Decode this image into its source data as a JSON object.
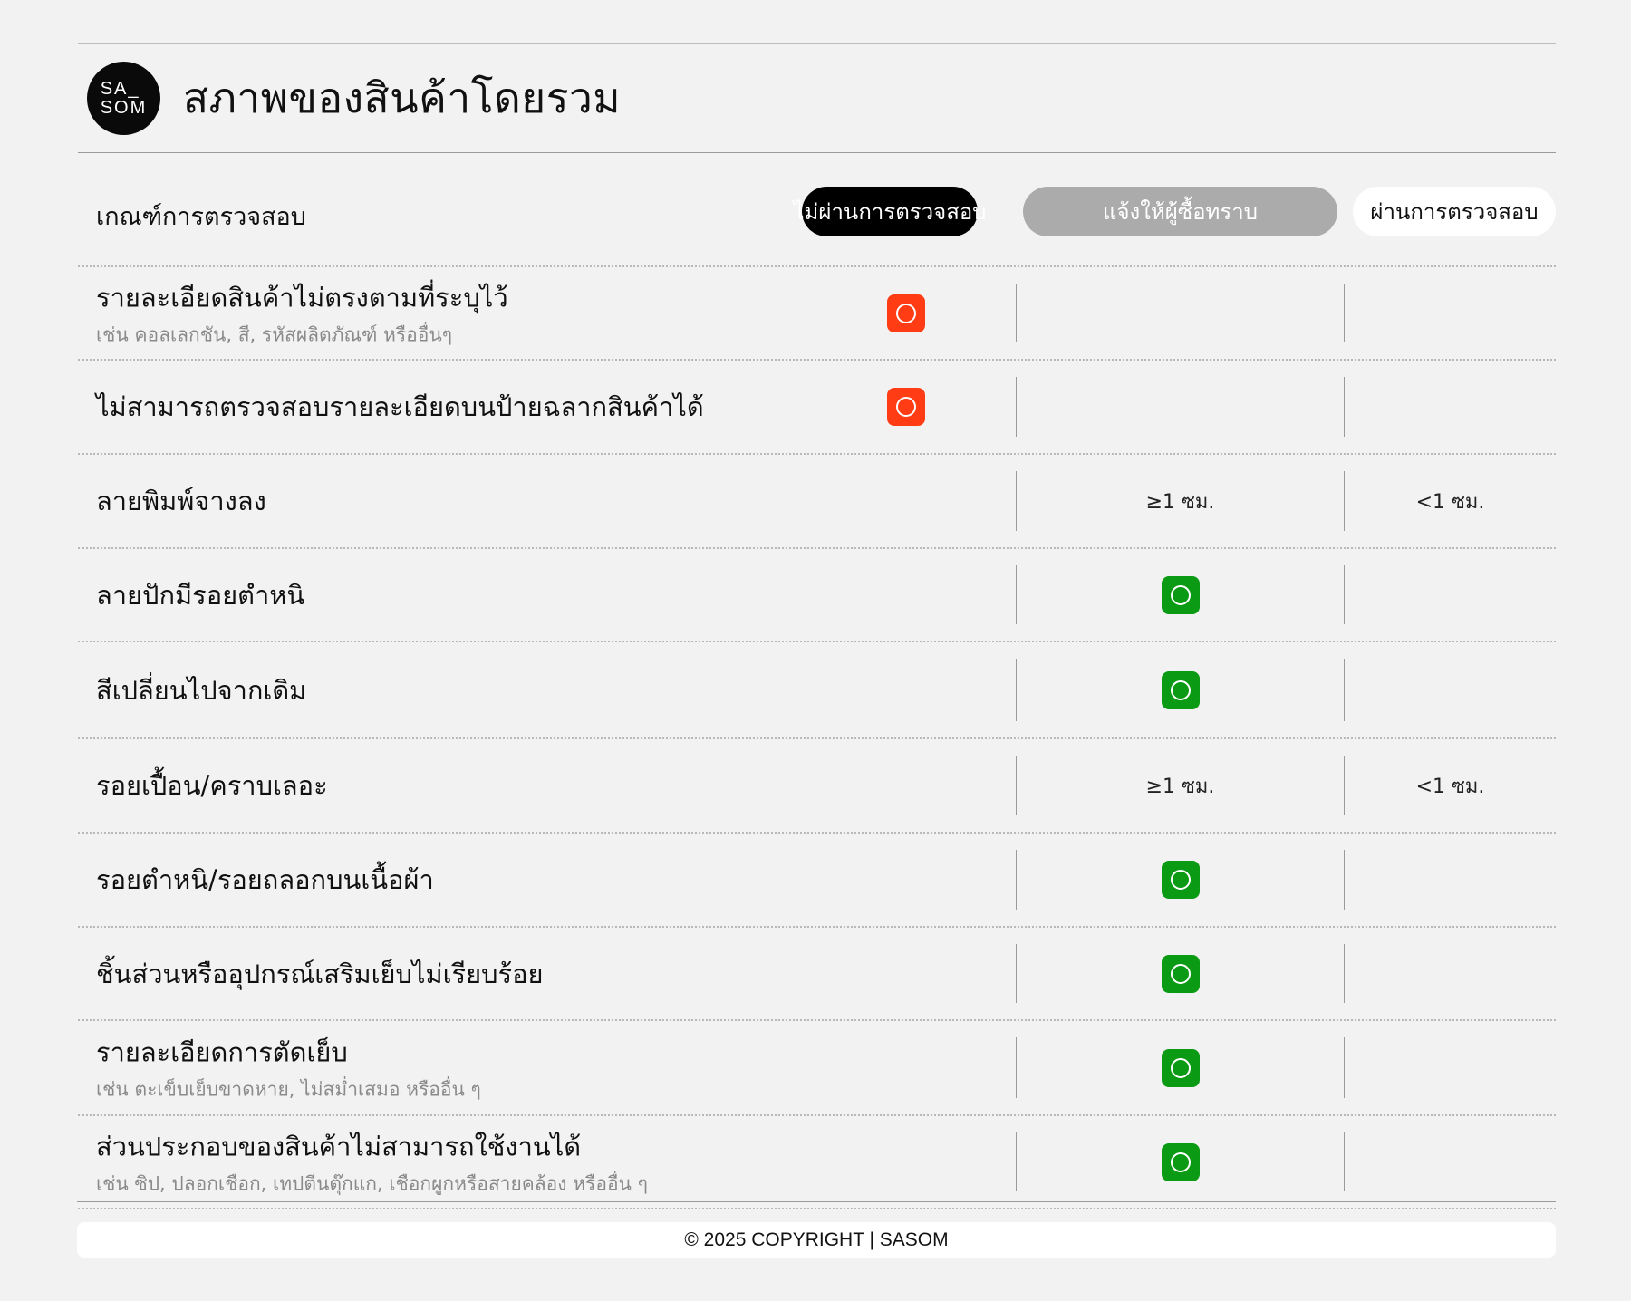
{
  "brand": {
    "logo_text": "SA_\nSOM"
  },
  "page": {
    "title": "สภาพของสินค้าโดยรวม"
  },
  "columns": {
    "criteria": "เกณฑ์การตรวจสอบ",
    "fail": "ไม่ผ่านการตรวจสอบ",
    "notify": "แจ้งให้ผู้ซื้อทราบ",
    "pass": "ผ่านการตรวจสอบ"
  },
  "colors": {
    "fail": "#ff3c14",
    "notify": "#0a9a14"
  },
  "rows": [
    {
      "label": "รายละเอียดสินค้าไม่ตรงตามที่ระบุไว้",
      "sub": "เช่น คอลเลกชัน, สี, รหัสผลิตภัณฑ์ หรืออื่นๆ",
      "fail": "icon",
      "notify": "",
      "pass": ""
    },
    {
      "label": "ไม่สามารถตรวจสอบรายละเอียดบนป้ายฉลากสินค้าได้",
      "sub": "",
      "fail": "icon",
      "notify": "",
      "pass": ""
    },
    {
      "label": "ลายพิมพ์จางลง",
      "sub": "",
      "fail": "",
      "notify": "≥1 ซม.",
      "pass": "<1 ซม."
    },
    {
      "label": "ลายปักมีรอยตำหนิ",
      "sub": "",
      "fail": "",
      "notify": "icon",
      "pass": ""
    },
    {
      "label": "สีเปลี่ยนไปจากเดิม",
      "sub": "",
      "fail": "",
      "notify": "icon",
      "pass": ""
    },
    {
      "label": "รอยเปื้อน/คราบเลอะ",
      "sub": "",
      "fail": "",
      "notify": "≥1 ซม.",
      "pass": "<1 ซม."
    },
    {
      "label": "รอยตำหนิ/รอยถลอกบนเนื้อผ้า",
      "sub": "",
      "fail": "",
      "notify": "icon",
      "pass": ""
    },
    {
      "label": "ชิ้นส่วนหรืออุปกรณ์เสริมเย็บไม่เรียบร้อย",
      "sub": "",
      "fail": "",
      "notify": "icon",
      "pass": ""
    },
    {
      "label": "รายละเอียดการตัดเย็บ",
      "sub": "เช่น ตะเข็บเย็บขาดหาย, ไม่สม่ำเสมอ หรืออื่น ๆ",
      "fail": "",
      "notify": "icon",
      "pass": ""
    },
    {
      "label": "ส่วนประกอบของสินค้าไม่สามารถใช้งานได้",
      "sub": "เช่น ซิป, ปลอกเชือก, เทปตีนตุ๊กแก, เชือกผูกหรือสายคล้อง หรืออื่น ๆ",
      "fail": "",
      "notify": "icon",
      "pass": ""
    }
  ],
  "footer": {
    "text": "© 2025 COPYRIGHT | SASOM"
  }
}
